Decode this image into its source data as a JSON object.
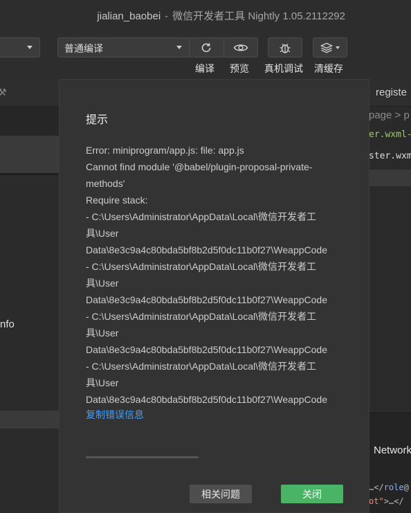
{
  "window": {
    "project": "jialian_baobei",
    "separator": "-",
    "app": "微信开发者工具 Nightly 1.05.2112292"
  },
  "toolbar": {
    "compile_mode": "普通编译",
    "labels": {
      "compile": "编译",
      "preview": "预览",
      "remote_debug": "真机调试",
      "clear_cache": "清缓存"
    },
    "icons": {
      "refresh": "refresh-icon",
      "preview": "eye-icon",
      "debug": "bug-icon",
      "cache": "layers-icon"
    }
  },
  "left_panel": {
    "info_text": "nfo"
  },
  "right_panel": {
    "tab": "registe",
    "breadcrumb": "page > p",
    "line1": "er.wxml-",
    "line2": "ster.wxm",
    "network_tab": "Network",
    "code1_open": "…</",
    "code1_tag": "role",
    "code1_rest": "@",
    "code2_attr": "ot\"",
    "code2_rest": ">…</"
  },
  "dialog": {
    "title": "提示",
    "lines": [
      "Error: miniprogram/app.js: file: app.js",
      "Cannot find module '@babel/plugin-proposal-private-",
      "methods'",
      "Require stack:",
      "- C:\\Users\\Administrator\\AppData\\Local\\微信开发者工",
      "具\\User",
      "Data\\8e3c9a4c80bda5bf8b2d5f0dc11b0f27\\WeappCode",
      "- C:\\Users\\Administrator\\AppData\\Local\\微信开发者工",
      "具\\User",
      "Data\\8e3c9a4c80bda5bf8b2d5f0dc11b0f27\\WeappCode",
      "- C:\\Users\\Administrator\\AppData\\Local\\微信开发者工",
      "具\\User",
      "Data\\8e3c9a4c80bda5bf8b2d5f0dc11b0f27\\WeappCode",
      "- C:\\Users\\Administrator\\AppData\\Local\\微信开发者工",
      "具\\User",
      "Data\\8e3c9a4c80bda5bf8b2d5f0dc11b0f27\\WeappCode"
    ],
    "copy_link": "复制错误信息",
    "related_button": "相关问题",
    "close_button": "关闭"
  },
  "colors": {
    "accent_green": "#48b464",
    "link_blue": "#3fa0ff"
  }
}
